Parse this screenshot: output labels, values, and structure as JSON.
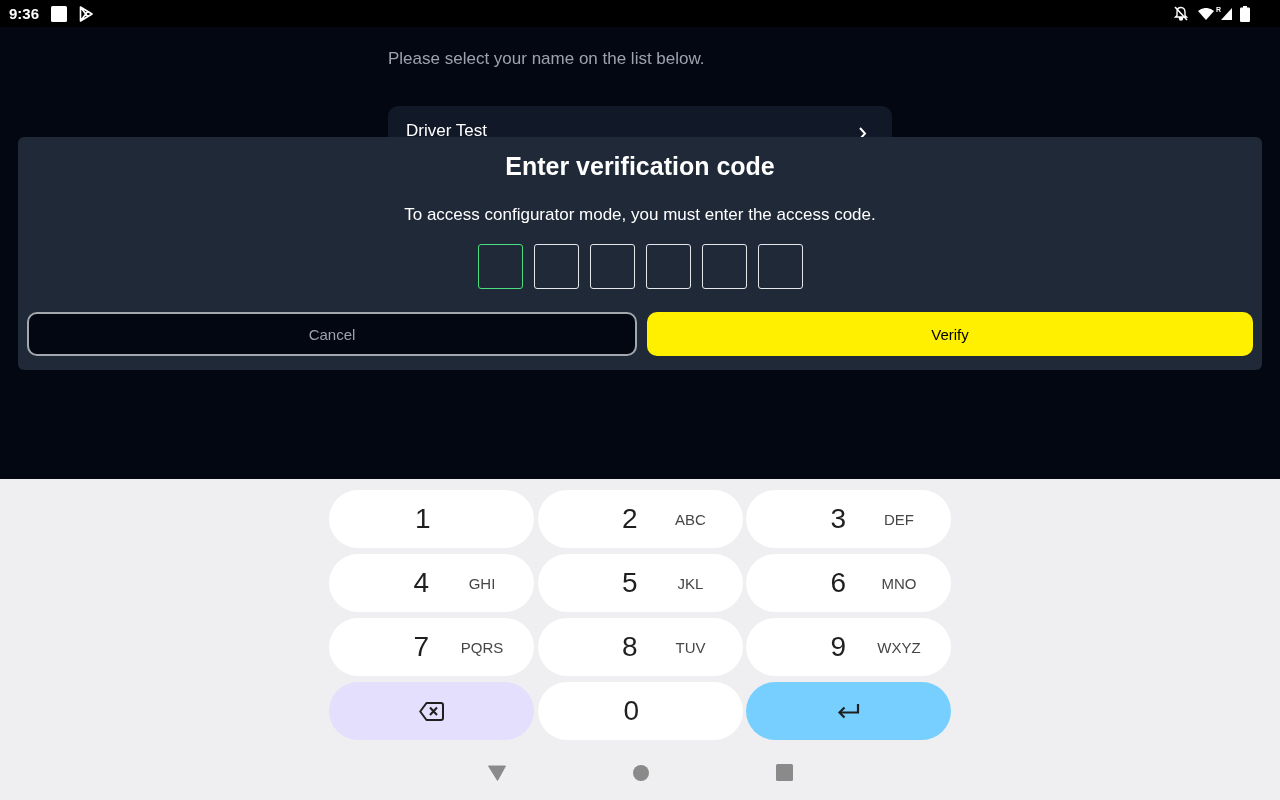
{
  "status_bar": {
    "time": "9:36",
    "roaming_mark": "R"
  },
  "page": {
    "instruction": "Please select your name on the list below.",
    "drivers": [
      {
        "name": "Driver Test"
      }
    ]
  },
  "dialog": {
    "title": "Enter verification code",
    "message": "To access configurator mode, you must enter the access code.",
    "code_fields": [
      {
        "focused": true
      },
      {
        "focused": false
      },
      {
        "focused": false
      },
      {
        "focused": false
      },
      {
        "focused": false
      },
      {
        "focused": false
      }
    ],
    "buttons": [
      {
        "label": "Cancel",
        "kind": "secondary"
      },
      {
        "label": "Verify",
        "kind": "primary"
      }
    ]
  },
  "keypad": {
    "keys": [
      {
        "kind": "digit",
        "digit": "1"
      },
      {
        "kind": "digit",
        "digit": "2",
        "letters": "ABC"
      },
      {
        "kind": "digit",
        "digit": "3",
        "letters": "DEF"
      },
      {
        "kind": "digit",
        "digit": "4",
        "letters": "GHI"
      },
      {
        "kind": "digit",
        "digit": "5",
        "letters": "JKL"
      },
      {
        "kind": "digit",
        "digit": "6",
        "letters": "MNO"
      },
      {
        "kind": "digit",
        "digit": "7",
        "letters": "PQRS"
      },
      {
        "kind": "digit",
        "digit": "8",
        "letters": "TUV"
      },
      {
        "kind": "digit",
        "digit": "9",
        "letters": "WXYZ"
      },
      {
        "kind": "backspace"
      },
      {
        "kind": "digit",
        "digit": "0"
      },
      {
        "kind": "enter"
      }
    ]
  }
}
